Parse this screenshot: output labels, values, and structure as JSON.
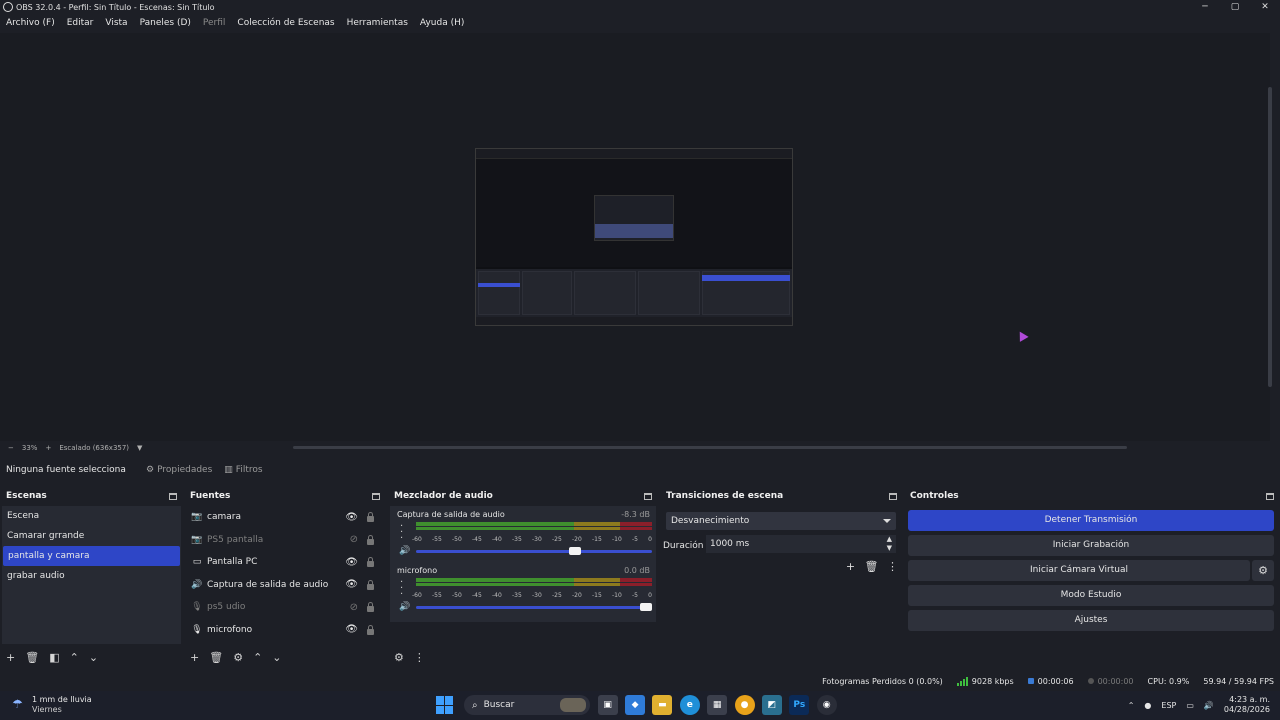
{
  "window": {
    "title": "OBS 32.0.4 - Perfil: Sin Título - Escenas: Sin Título",
    "minimize": "─",
    "maximize": "▢",
    "close": "✕"
  },
  "menu": [
    "Archivo (F)",
    "Editar",
    "Vista",
    "Paneles (D)",
    "Perfil",
    "Colección de Escenas",
    "Herramientas",
    "Ayuda (H)"
  ],
  "zoombar": {
    "minus": "−",
    "zoom": "33%",
    "plus": "+",
    "scale": "Escalado (636x357)",
    "dropdown": "▼"
  },
  "source_toolbar": {
    "none_selected": "Ninguna fuente selecciona",
    "properties": "Propiedades",
    "filters": "Filtros"
  },
  "scenes": {
    "title": "Escenas",
    "items": [
      "Escena",
      "Camarar grrande",
      "pantalla y camara",
      "grabar audio"
    ],
    "selected_index": 2
  },
  "sources": {
    "title": "Fuentes",
    "items": [
      {
        "label": "camara",
        "icon": "camera-icon",
        "visible": true
      },
      {
        "label": "PS5 pantalla",
        "icon": "camera-icon",
        "visible": false
      },
      {
        "label": "Pantalla PC",
        "icon": "monitor-icon",
        "visible": true
      },
      {
        "label": "Captura de salida de audio",
        "icon": "speaker-icon",
        "visible": true
      },
      {
        "label": "ps5 udio",
        "icon": "microphone-icon",
        "visible": false
      },
      {
        "label": "microfono",
        "icon": "microphone-icon",
        "visible": true
      }
    ]
  },
  "mixer": {
    "title": "Mezclador de audio",
    "scale": [
      "-60",
      "-55",
      "-50",
      "-45",
      "-40",
      "-35",
      "-30",
      "-25",
      "-20",
      "-15",
      "-10",
      "-5",
      "0"
    ],
    "channels": [
      {
        "name": "Captura de salida de audio",
        "db": "-8.3 dB",
        "volume": 0.7
      },
      {
        "name": "microfono",
        "db": "0.0 dB",
        "volume": 1.0
      }
    ]
  },
  "transitions": {
    "title": "Transiciones de escena",
    "selected": "Desvanecimiento",
    "duration_label": "Duración",
    "duration_value": "1000 ms"
  },
  "controls": {
    "title": "Controles",
    "buttons": [
      "Detener Transmisión",
      "Iniciar Grabación",
      "Iniciar Cámara Virtual",
      "Modo Estudio",
      "Ajustes"
    ]
  },
  "statusbar": {
    "dropped": "Fotogramas Perdidos 0 (0.0%)",
    "bitrate": "9028 kbps",
    "stream_time": "00:00:06",
    "record_time": "00:00:00",
    "cpu": "CPU: 0.9%",
    "fps": "59.94 / 59.94 FPS"
  },
  "taskbar": {
    "weather_main": "1 mm de lluvia",
    "weather_sub": "Viernes",
    "search": "Buscar",
    "lang": "ESP",
    "time": "4:23 a. m.",
    "date": "04/28/2026"
  },
  "colors": {
    "accent": "#2e46c7",
    "background": "#1d1f26",
    "panel": "#272a33"
  }
}
